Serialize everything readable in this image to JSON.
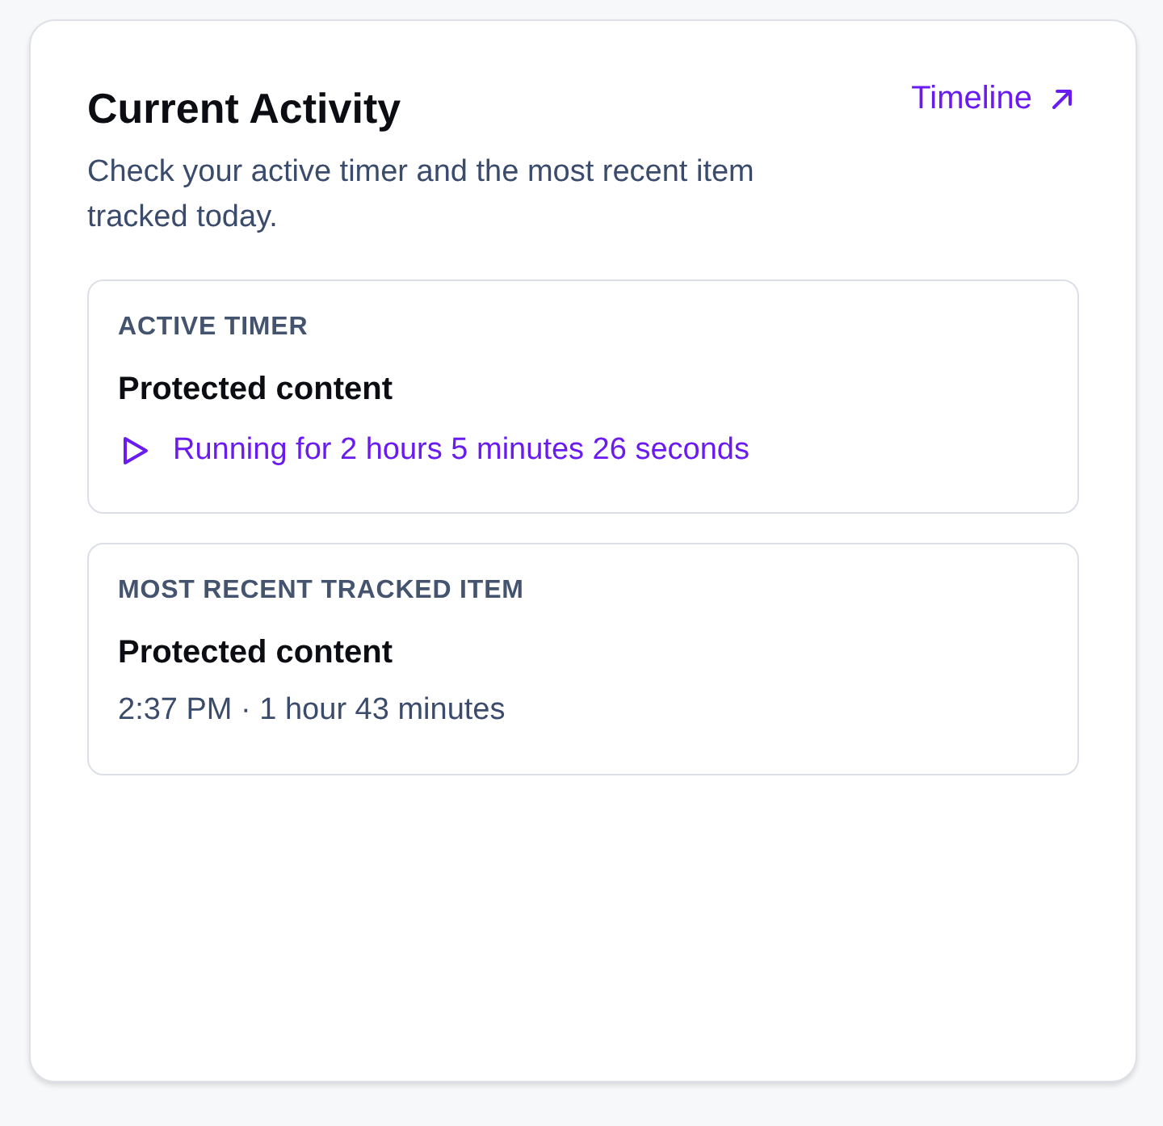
{
  "header": {
    "title": "Current Activity",
    "link": "Timeline",
    "description": "Check your active timer and the most recent item tracked today."
  },
  "items": [
    {
      "kind": "timer",
      "label": "ACTIVE TIMER",
      "title": "Protected content",
      "status": "Running for 2 hours 5 minutes 26 seconds"
    },
    {
      "kind": "recent",
      "label": "MOST RECENT TRACKED ITEM",
      "title": "Protected content",
      "status": "2:37 PM · 1 hour 43 minutes"
    }
  ]
}
